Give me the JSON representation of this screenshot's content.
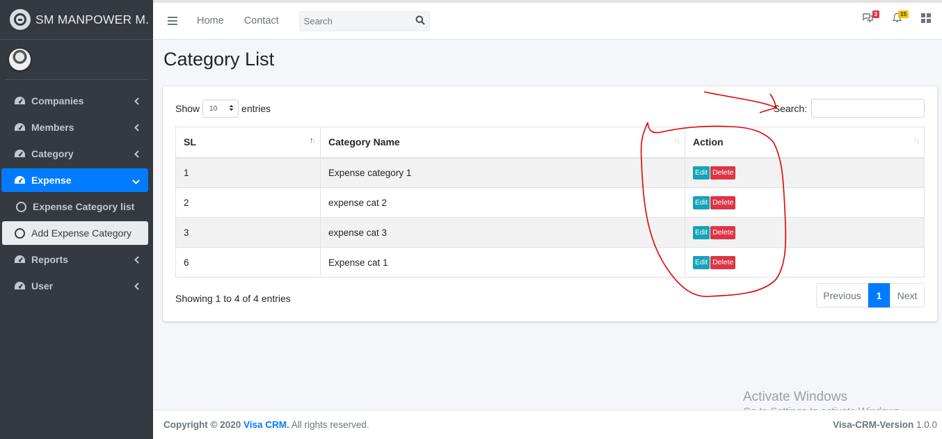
{
  "brand": {
    "name": "SM MANPOWER M."
  },
  "sidebar": {
    "items": [
      {
        "label": "Companies"
      },
      {
        "label": "Members"
      },
      {
        "label": "Category"
      },
      {
        "label": "Expense"
      },
      {
        "label": "Expense Category list"
      },
      {
        "label": "Add Expense Category"
      },
      {
        "label": "Reports"
      },
      {
        "label": "User"
      }
    ]
  },
  "topbar": {
    "links": [
      "Home",
      "Contact"
    ],
    "search_placeholder": "Search",
    "messages_badge": "3",
    "notifications_badge": "15"
  },
  "page": {
    "title": "Category List"
  },
  "table": {
    "show_label": "Show",
    "page_length": "10",
    "entries_label": "entries",
    "search_label": "Search:",
    "headers": [
      "SL",
      "Category Name",
      "Action"
    ],
    "rows": [
      {
        "sl": "1",
        "name": "Expense category 1"
      },
      {
        "sl": "2",
        "name": "expense cat 2"
      },
      {
        "sl": "3",
        "name": "expense cat 3"
      },
      {
        "sl": "6",
        "name": "Expense cat 1"
      }
    ],
    "edit_label": "Edit",
    "delete_label": "Delete",
    "info": "Showing 1 to 4 of 4 entries",
    "pager": {
      "previous": "Previous",
      "current": "1",
      "next": "Next"
    }
  },
  "footer": {
    "copyright": "Copyright © 2020",
    "brand_link": "Visa CRM.",
    "rights": "All rights reserved.",
    "version_label": "Visa-CRM-Version",
    "version": "1.0.0"
  },
  "watermark": {
    "line1": "Activate Windows",
    "line2": "Go to Settings to activate Windows."
  },
  "colors": {
    "sidebar": "#343a40",
    "primary": "#007bff",
    "edit": "#17a2b8",
    "delete": "#dc3545",
    "annotation": "#e00000"
  }
}
